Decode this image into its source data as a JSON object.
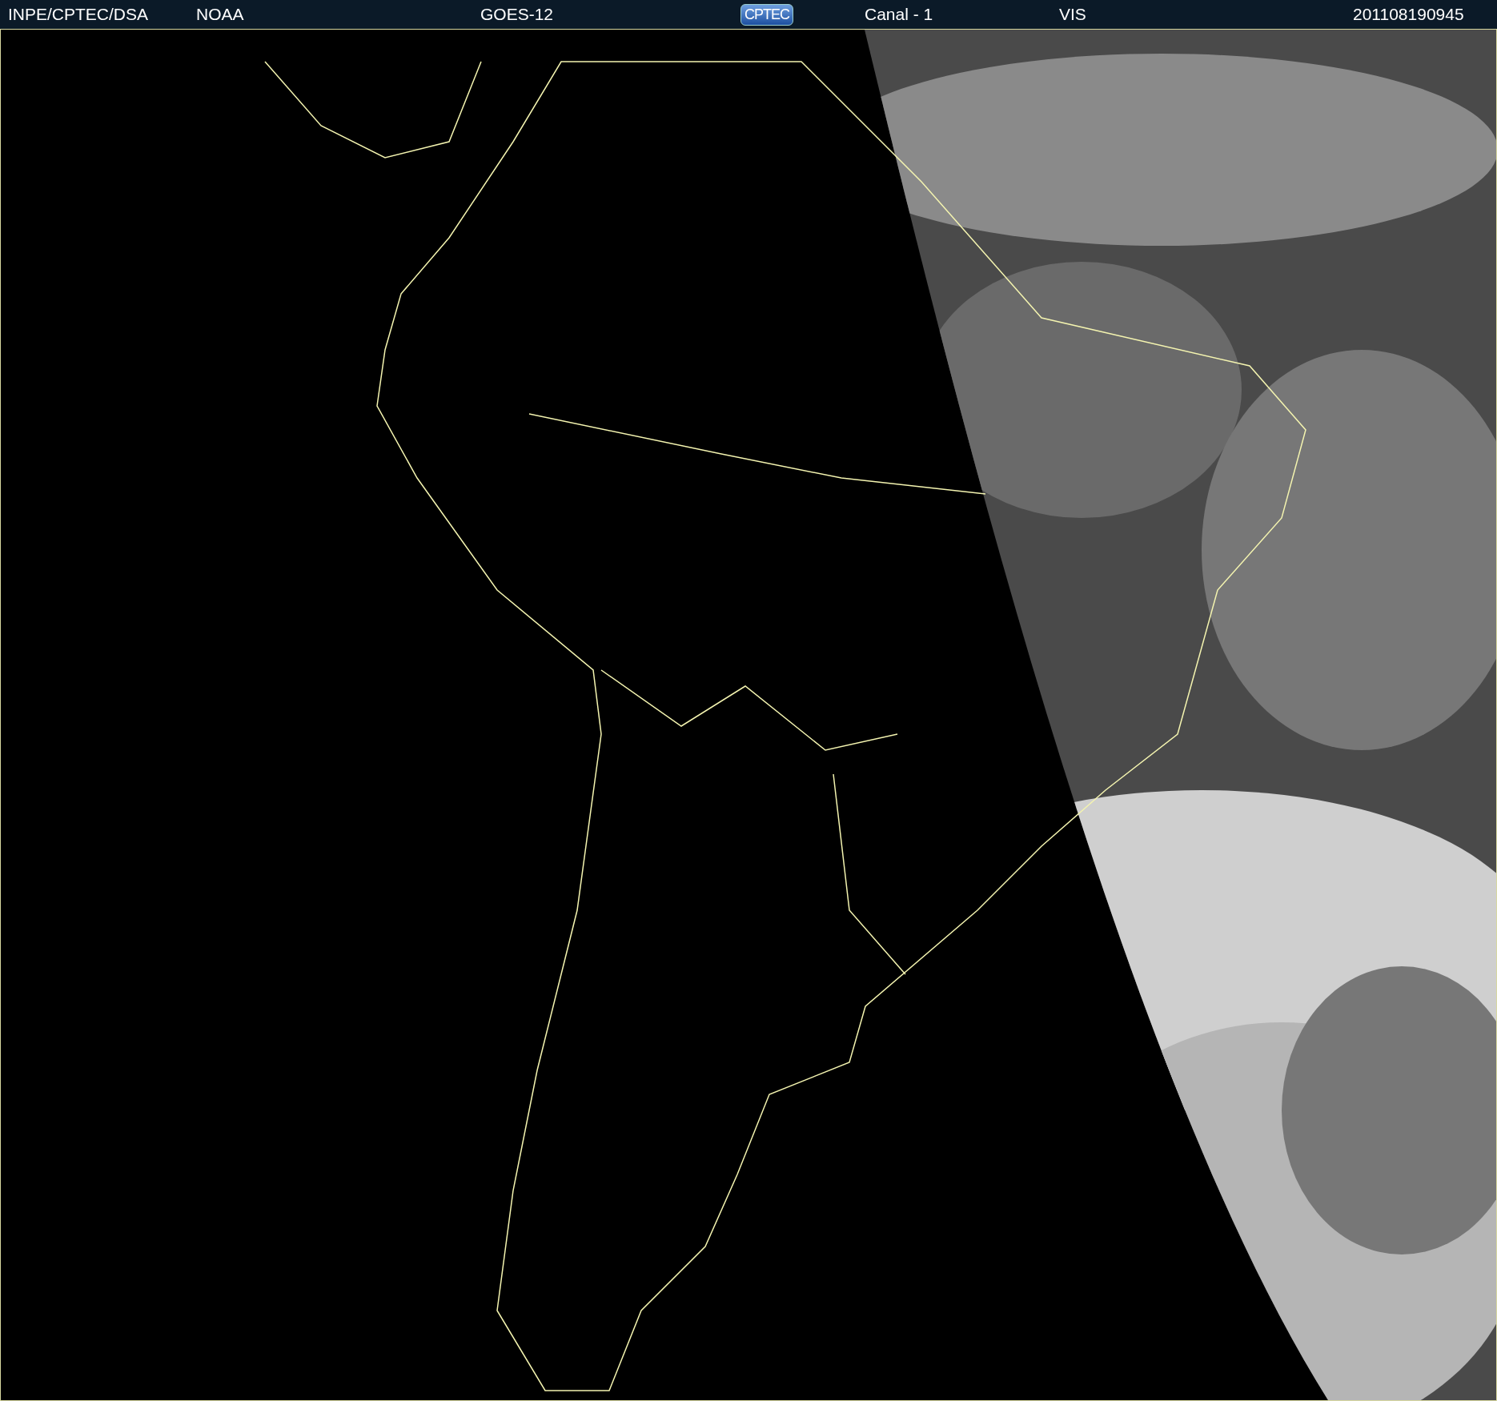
{
  "header": {
    "source": "INPE/CPTEC/DSA",
    "agency": "NOAA",
    "satellite": "GOES-12",
    "logo": "CPTEC",
    "channel": "Canal - 1",
    "band": "VIS",
    "timestamp": "201108190945"
  }
}
